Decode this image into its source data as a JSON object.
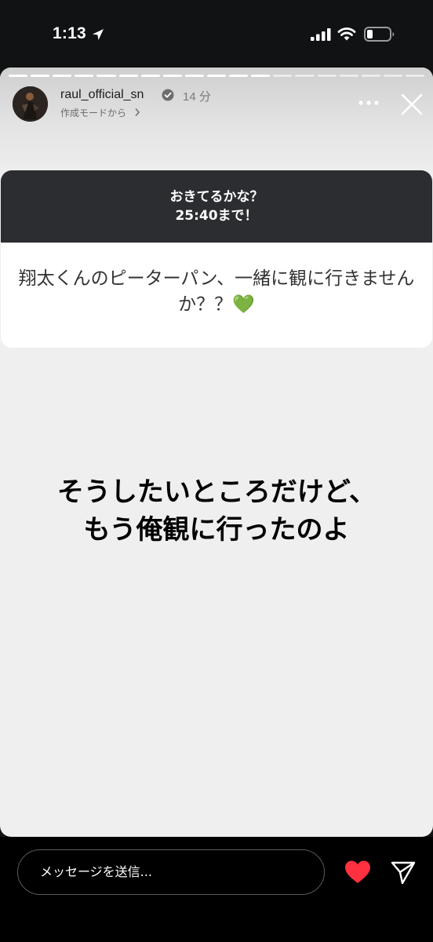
{
  "status_bar": {
    "time": "1:13"
  },
  "story": {
    "progress": {
      "total_segments": 19,
      "completed_segments": 12
    },
    "user": {
      "username": "raul_official_sn",
      "time_ago": "14 分",
      "subline": "作成モードから"
    },
    "question_card": {
      "header_line1": "おきてるかな？",
      "header_line2": "25:40まで！",
      "question": "翔太くんのピーターパン、一緒に観に行きませんか？？💚"
    },
    "answer": {
      "line1": "そうしたいところだけど、",
      "line2": "もう俺観に行ったのよ"
    }
  },
  "reply_bar": {
    "placeholder": "メッセージを送信..."
  },
  "colors": {
    "like": "#ff3040",
    "question_header": "#2c2d30",
    "story_bg": "#efefef"
  }
}
